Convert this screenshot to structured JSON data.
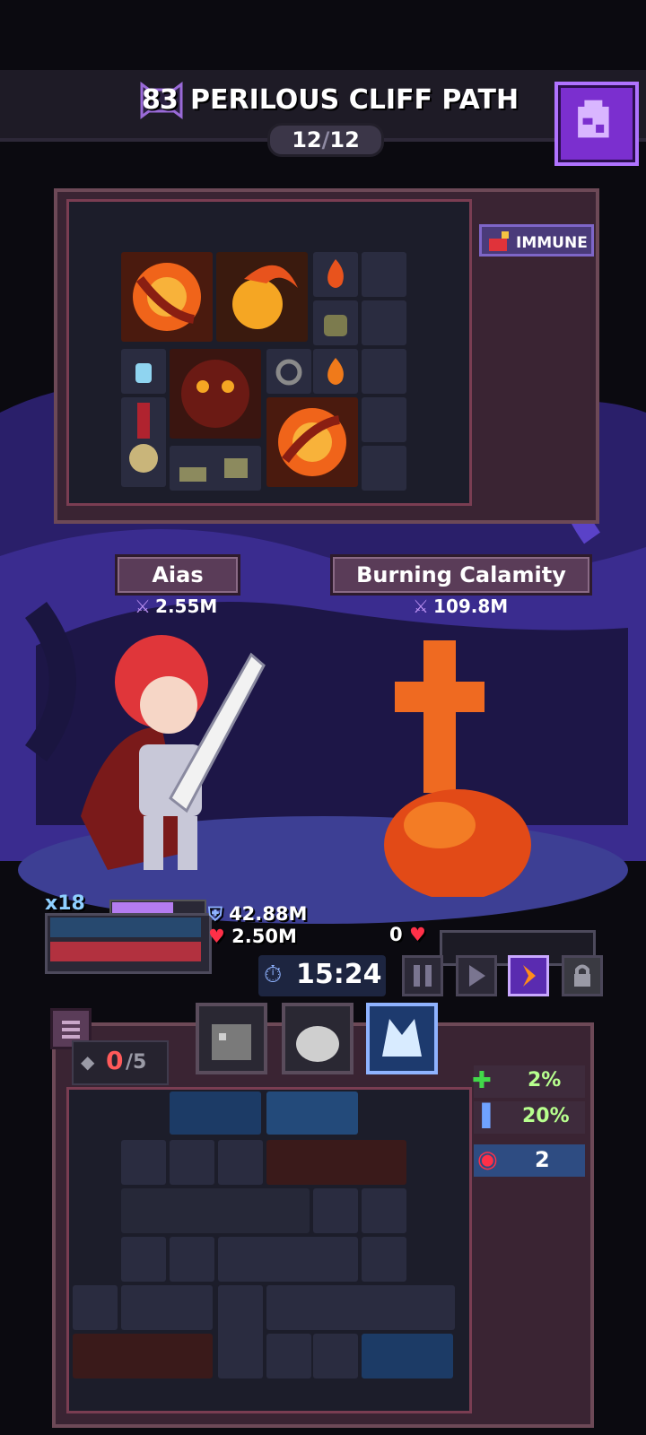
{
  "header": {
    "level": "83",
    "stage_name": "PERILOUS CLIFF PATH",
    "progress_current": "12",
    "progress_sep": "/",
    "progress_total": "12"
  },
  "loot": {
    "status_label": "IMMUNE"
  },
  "hero": {
    "name": "Aias",
    "power": "2.55M",
    "multiplier": "x18",
    "shield": "42.88M",
    "health": "2.50M"
  },
  "enemy": {
    "name": "Burning Calamity",
    "power": "109.8M",
    "health": "0"
  },
  "battle": {
    "timer": "15:24"
  },
  "inventory": {
    "slots_used": "0",
    "slots_total": "/5",
    "stats": [
      {
        "label": "2%",
        "icon": "heal-plus-icon"
      },
      {
        "label": "20%",
        "icon": "armor-bars-icon"
      },
      {
        "label": "2",
        "icon": "demon-face-icon"
      }
    ]
  },
  "colors": {
    "accent_purple": "#7b2fcf",
    "hp_red": "#b2313f",
    "shield_blue": "#27496f",
    "frame": "#3a2433"
  }
}
